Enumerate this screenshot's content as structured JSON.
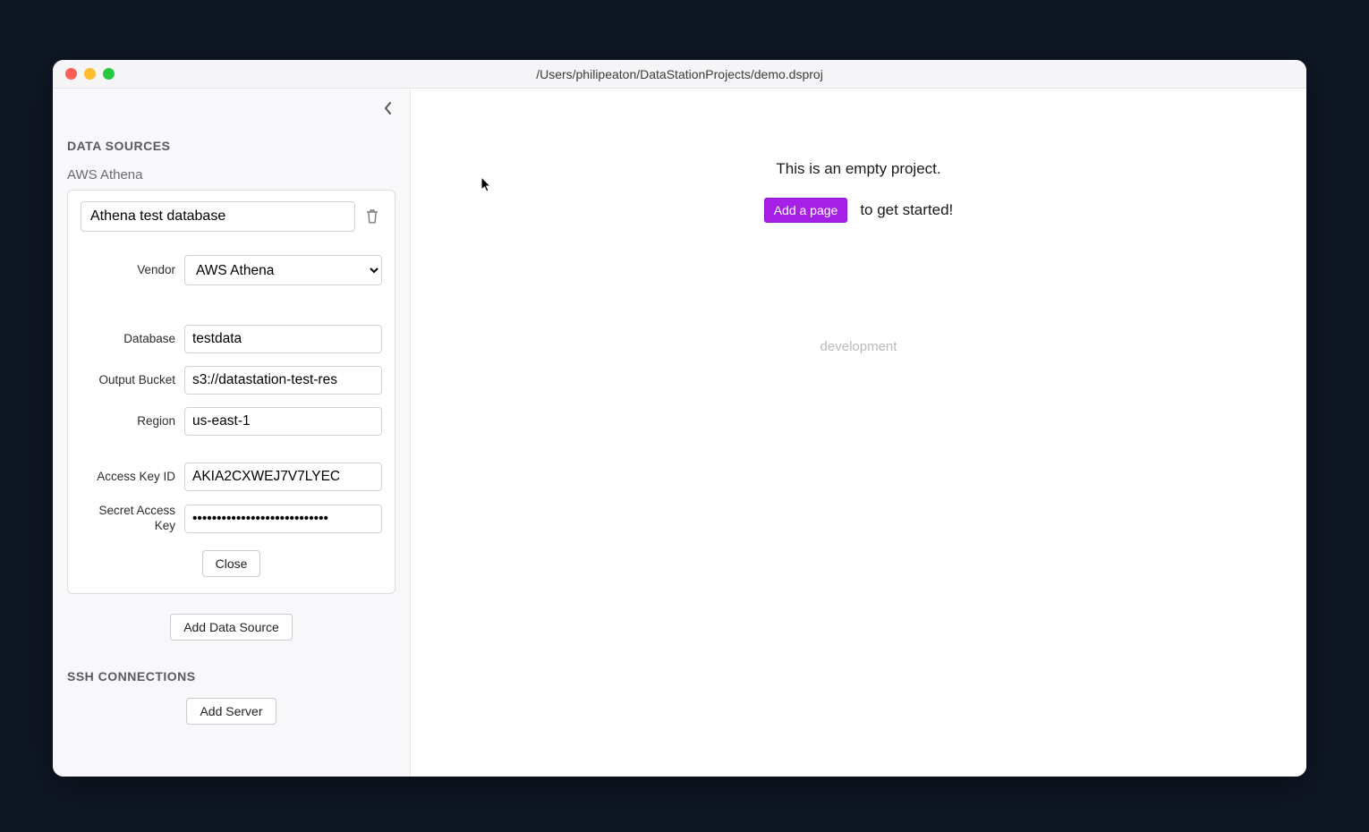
{
  "window": {
    "title": "/Users/philipeaton/DataStationProjects/demo.dsproj"
  },
  "sidebar": {
    "data_sources_h": "DATA SOURCES",
    "source_label": "AWS Athena",
    "name_value": "Athena test database",
    "vendor_label": "Vendor",
    "vendor_value": "AWS Athena",
    "database_label": "Database",
    "database_value": "testdata",
    "output_bucket_label": "Output Bucket",
    "output_bucket_value": "s3://datastation-test-res",
    "region_label": "Region",
    "region_value": "us-east-1",
    "access_key_label": "Access Key ID",
    "access_key_value": "AKIA2CXWEJ7V7LYEC",
    "secret_label": "Secret Access Key",
    "secret_value": "••••••••••••••••••••••••••••",
    "close_label": "Close",
    "add_ds_label": "Add Data Source",
    "ssh_h": "SSH CONNECTIONS",
    "add_server_label": "Add Server"
  },
  "main": {
    "empty_text": "This is an empty project.",
    "add_page_label": "Add a page",
    "suffix_text": "to get started!",
    "dev_text": "development"
  }
}
